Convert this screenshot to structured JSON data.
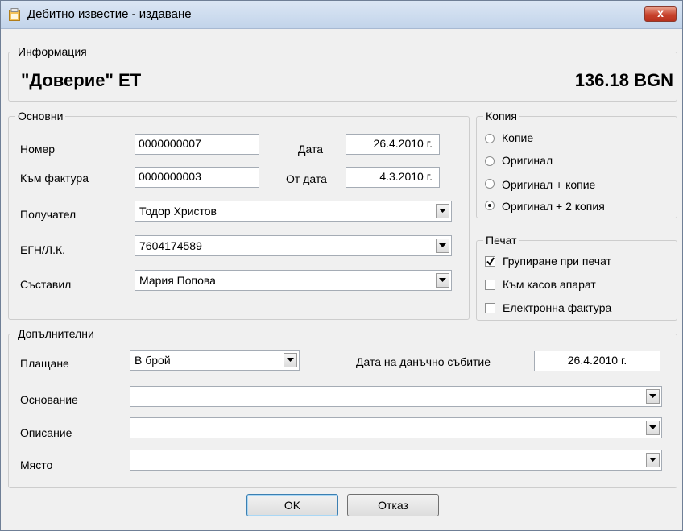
{
  "window": {
    "title": "Дебитно известие - издаване",
    "close_label": "x"
  },
  "info": {
    "legend": "Информация",
    "company": "\"Доверие\" ЕТ",
    "amount": "136.18 BGN"
  },
  "basic": {
    "legend": "Основни",
    "number_label": "Номер",
    "number_value": "0000000007",
    "date_label": "Дата",
    "date_value": "26.4.2010 г.",
    "invoice_label": "Към фактура",
    "invoice_value": "0000000003",
    "from_date_label": "От дата",
    "from_date_value": "4.3.2010 г.",
    "recipient_label": "Получател",
    "recipient_value": "Тодор Христов",
    "egn_label": "ЕГН/Л.К.",
    "egn_value": "7604174589",
    "author_label": "Съставил",
    "author_value": "Мария Попова"
  },
  "copies": {
    "legend": "Копия",
    "options": [
      {
        "label": "Копие",
        "selected": false
      },
      {
        "label": "Оригинал",
        "selected": false
      },
      {
        "label": "Оригинал + копие",
        "selected": false
      },
      {
        "label": "Оригинал + 2 копия",
        "selected": true
      }
    ]
  },
  "print": {
    "legend": "Печат",
    "options": [
      {
        "label": "Групиране при печат",
        "checked": true
      },
      {
        "label": "Към касов апарат",
        "checked": false
      },
      {
        "label": "Електронна фактура",
        "checked": false
      }
    ]
  },
  "additional": {
    "legend": "Допълнителни",
    "payment_label": "Плащане",
    "payment_value": "В брой",
    "tax_date_label": "Дата на данъчно събитие",
    "tax_date_value": "26.4.2010 г.",
    "basis_label": "Основание",
    "basis_value": "",
    "description_label": "Описание",
    "description_value": "",
    "place_label": "Място",
    "place_value": ""
  },
  "buttons": {
    "ok": "OK",
    "cancel": "Отказ"
  }
}
